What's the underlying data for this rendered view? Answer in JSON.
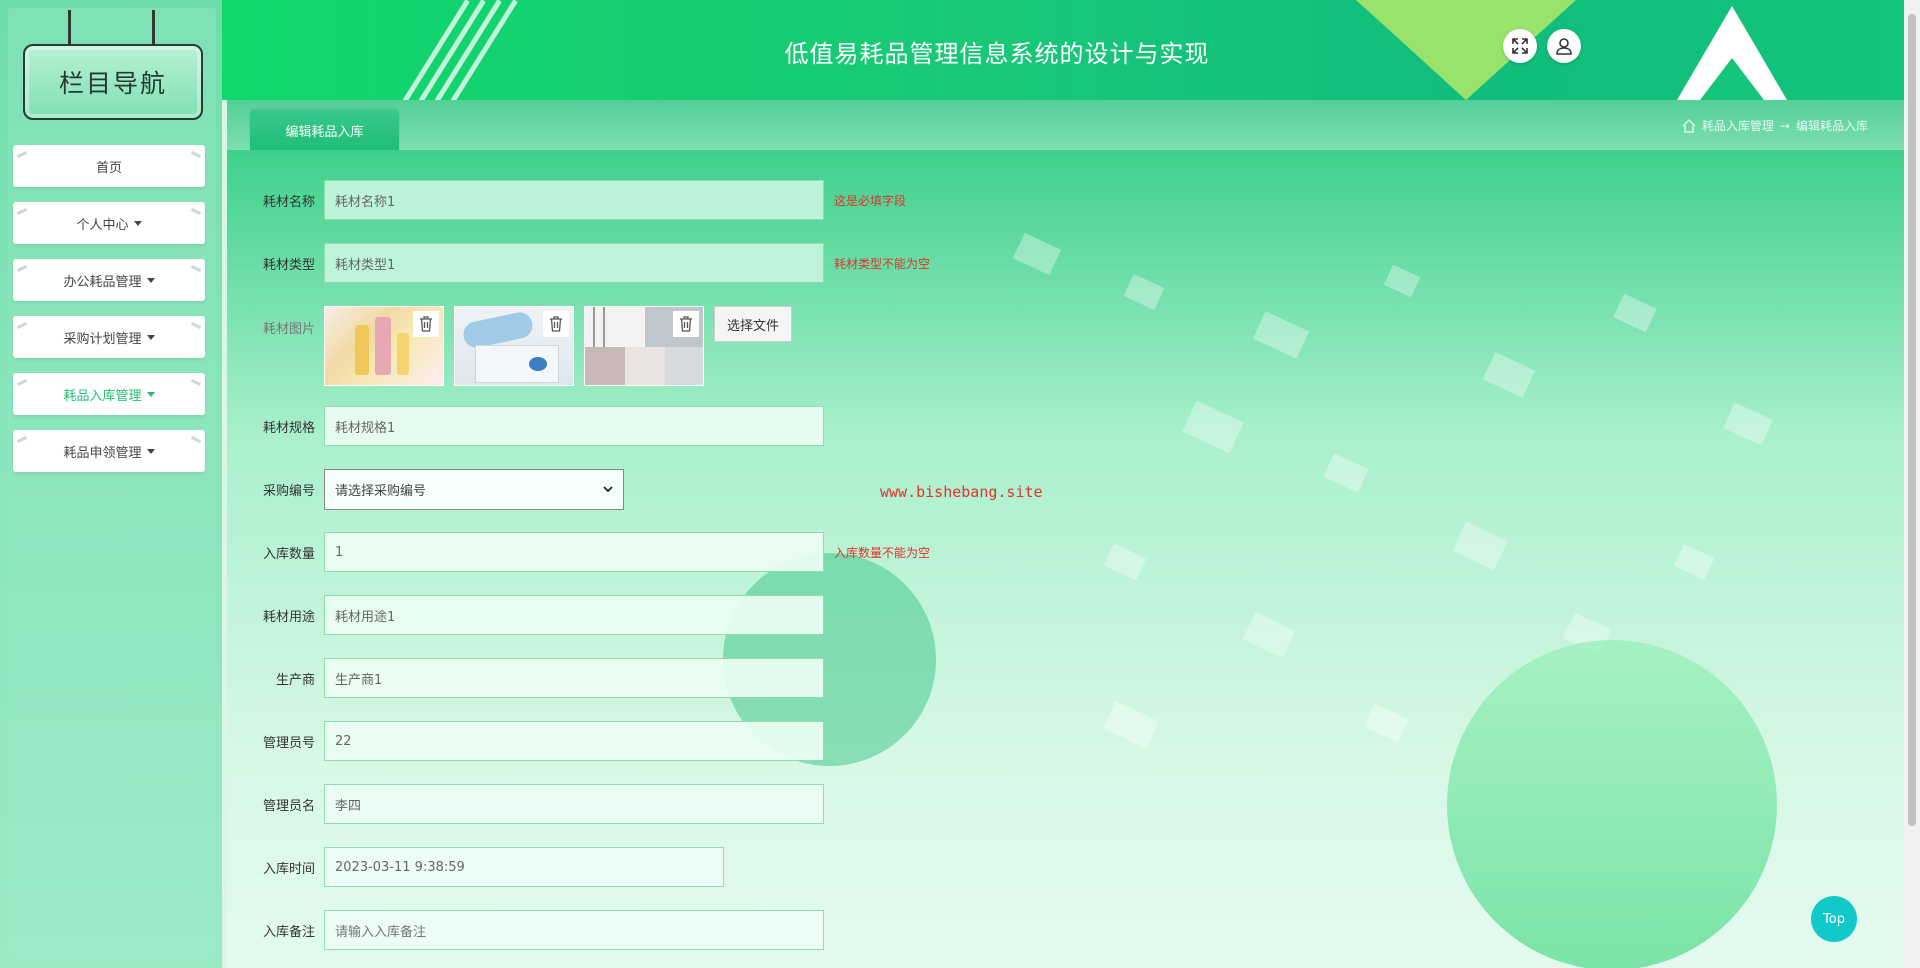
{
  "sidebar": {
    "title": "栏目导航",
    "items": [
      {
        "label": "首页",
        "caret": false
      },
      {
        "label": "个人中心",
        "caret": true
      },
      {
        "label": "办公耗品管理",
        "caret": true
      },
      {
        "label": "采购计划管理",
        "caret": true
      },
      {
        "label": "耗品入库管理",
        "caret": true,
        "active": true
      },
      {
        "label": "耗品申领管理",
        "caret": true
      }
    ]
  },
  "header": {
    "title": "低值易耗品管理信息系统的设计与实现",
    "fullscreen_icon": "expand-icon",
    "user_icon": "user-icon"
  },
  "tabbar": {
    "active_tab": "编辑耗品入库",
    "breadcrumb": [
      "耗品入库管理",
      "编辑耗品入库"
    ],
    "breadcrumb_sep": "→"
  },
  "form": {
    "name": {
      "label": "耗材名称",
      "value": "耗材名称1",
      "error": "这是必填字段"
    },
    "type": {
      "label": "耗材类型",
      "value": "耗材类型1",
      "error": "耗材类型不能为空"
    },
    "images": {
      "label": "耗材图片",
      "button": "选择文件"
    },
    "spec": {
      "label": "耗材规格",
      "value": "耗材规格1"
    },
    "purchase_no": {
      "label": "采购编号",
      "value": "请选择采购编号"
    },
    "qty": {
      "label": "入库数量",
      "value": "1",
      "error": "入库数量不能为空"
    },
    "usage": {
      "label": "耗材用途",
      "value": "耗材用途1"
    },
    "maker": {
      "label": "生产商",
      "value": "生产商1"
    },
    "admin_no": {
      "label": "管理员号",
      "value": "22"
    },
    "admin_name": {
      "label": "管理员名",
      "value": "李四"
    },
    "time": {
      "label": "入库时间",
      "value": "2023-03-11 9:38:59"
    },
    "remark": {
      "label": "入库备注",
      "placeholder": "请输入入库备注"
    }
  },
  "watermark": "www.bishebang.site",
  "top_button": "Top",
  "colors": {
    "accent": "#1fbd78",
    "error": "#e3322a",
    "top": "#12c9c9"
  }
}
